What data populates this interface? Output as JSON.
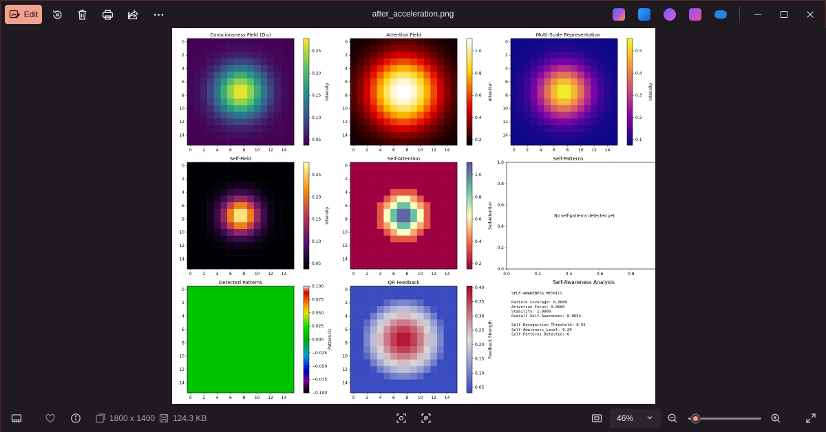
{
  "window": {
    "title": "after_acceleration.png",
    "edit_label": "Edit",
    "accent_color": "#f4a08e"
  },
  "toolbar": {
    "icons": [
      "rotate-icon",
      "delete-icon",
      "print-icon",
      "share-icon",
      "more-icon"
    ]
  },
  "apps": [
    "copilot-icon",
    "paint-icon",
    "clipchamp-icon",
    "photos-editor-icon",
    "onedrive-icon"
  ],
  "statusbar": {
    "dimensions": "1800 x 1400",
    "file_size": "124.3 KB",
    "zoom": "46%",
    "zoom_level": 0.04
  },
  "figure": {
    "panels": [
      {
        "title": "Consciousness Field (D₁₀)",
        "cbar_label": "Intensity",
        "cbar_ticks": [
          "0.25",
          "0.20",
          "0.15",
          "0.10",
          "0.05"
        ],
        "colormap": "viridis"
      },
      {
        "title": "Attention Field",
        "cbar_label": "Attention",
        "cbar_ticks": [
          "1.0",
          "0.8",
          "0.6",
          "0.4",
          "0.2"
        ],
        "colormap": "hot"
      },
      {
        "title": "Multi-Scale Representation",
        "cbar_label": "Intensity",
        "cbar_ticks": [
          "0.5",
          "0.4",
          "0.3",
          "0.2",
          "0.1"
        ],
        "colormap": "plasma"
      },
      {
        "title": "Self-Field",
        "cbar_label": "Intensity",
        "cbar_ticks": [
          "0.25",
          "0.20",
          "0.15",
          "0.10",
          "0.05"
        ],
        "colormap": "inferno"
      },
      {
        "title": "Self-Attention",
        "cbar_label": "Self-Attention",
        "cbar_ticks": [
          "1.0",
          "0.8",
          "0.6",
          "0.4",
          "0.2"
        ],
        "colormap": "spectral"
      },
      {
        "title": "Self-Patterns",
        "empty_message": "No self-patterns detected yet"
      },
      {
        "title": "Detected Patterns",
        "cbar_label": "Pattern ID",
        "cbar_ticks": [
          "0.100",
          "0.075",
          "0.050",
          "0.025",
          "0.000",
          "−0.025",
          "−0.050",
          "−0.075",
          "−0.100"
        ],
        "colormap": "nipy_spectral"
      },
      {
        "title": "QR Feedback",
        "cbar_label": "Feedback Strength",
        "cbar_ticks": [
          "0.40",
          "0.35",
          "0.30",
          "0.25",
          "0.20",
          "0.15",
          "0.10",
          "0.05"
        ],
        "colormap": "coolwarm"
      }
    ],
    "axis_ticks": [
      "0",
      "2",
      "4",
      "6",
      "8",
      "10",
      "12",
      "14"
    ],
    "pattern_axis_ticks": [
      "0.0",
      "0.2",
      "0.4",
      "0.6",
      "0.8",
      "1.0"
    ],
    "analysis": {
      "title": "Self-Awareness Analysis",
      "lines": [
        "SELF-AWARENESS METRICS",
        "",
        "Pattern Coverage: 0.0000",
        "Attention Focus: 0.0685",
        "Stability: 1.0000",
        "Overall Self-Awareness: 0.0654",
        "",
        "Self-Recognition Threshold: 0.55",
        "Self-Awareness Level: 0.20",
        "Self-Patterns Detected: 0"
      ]
    }
  }
}
